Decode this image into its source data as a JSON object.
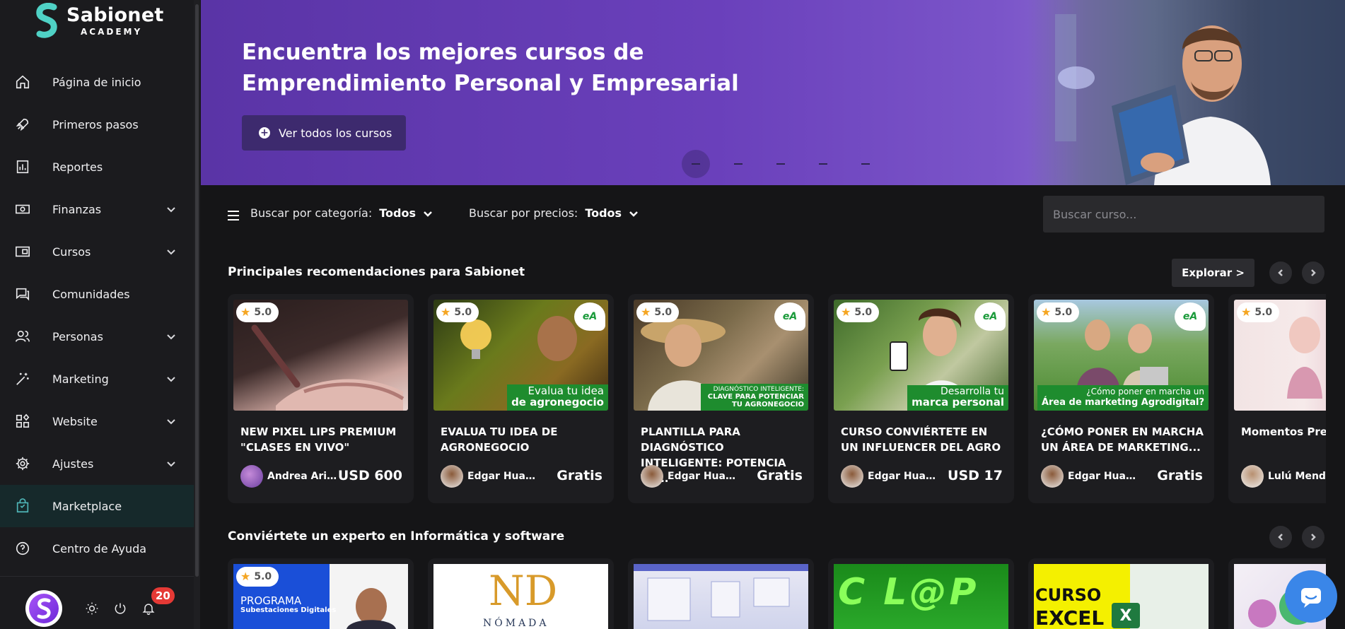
{
  "brand": {
    "name": "Sabionet",
    "sub": "ACADEMY"
  },
  "nav": [
    {
      "label": "Página de inicio",
      "icon": "home-icon",
      "chevron": false
    },
    {
      "label": "Primeros pasos",
      "icon": "rocket-icon",
      "chevron": false
    },
    {
      "label": "Reportes",
      "icon": "report-icon",
      "chevron": false
    },
    {
      "label": "Finanzas",
      "icon": "money-icon",
      "chevron": true
    },
    {
      "label": "Cursos",
      "icon": "course-icon",
      "chevron": true
    },
    {
      "label": "Comunidades",
      "icon": "chat-icon",
      "chevron": false
    },
    {
      "label": "Personas",
      "icon": "people-icon",
      "chevron": true
    },
    {
      "label": "Marketing",
      "icon": "magic-wand-icon",
      "chevron": true
    },
    {
      "label": "Website",
      "icon": "grid-icon",
      "chevron": true
    },
    {
      "label": "Ajustes",
      "icon": "gear-icon",
      "chevron": true
    },
    {
      "label": "Marketplace",
      "icon": "bag-icon",
      "chevron": false,
      "active": true
    },
    {
      "label": "Centro de Ayuda",
      "icon": "help-icon",
      "chevron": false
    }
  ],
  "footer": {
    "notifications": "20"
  },
  "banner": {
    "title": "Encuentra los mejores cursos de Emprendimiento Personal y Empresarial",
    "button": "Ver todos los cursos"
  },
  "filters": {
    "category_label": "Buscar por categoría:",
    "category_value": "Todos",
    "price_label": "Buscar por precios:",
    "price_value": "Todos",
    "search_placeholder": "Buscar curso..."
  },
  "section1": {
    "title": "Principales recomendaciones para Sabionet",
    "explore": "Explorar >"
  },
  "cards": [
    {
      "rating": "5.0",
      "title": "NEW PIXEL LIPS PREMIUM \"CLASES EN VIVO\"",
      "author": "Andrea Arias",
      "price": "USD 600"
    },
    {
      "rating": "5.0",
      "title": "EVALUA TU IDEA DE AGRONEGOCIO",
      "author": "Edgar Huam...",
      "price": "Gratis",
      "overlay1": "Evalua tu idea",
      "overlay2": "de agronegocio",
      "logo": "EDUCAGRO"
    },
    {
      "rating": "5.0",
      "title": "PLANTILLA PARA DIAGNÓSTICO INTELIGENTE: POTENCIA TU...",
      "author": "Edgar Huam...",
      "price": "Gratis",
      "overlay1": "DIAGNÓSTICO INTELIGENTE:",
      "overlay2": "CLAVE PARA POTENCIAR TU AGRONEGOCIO",
      "logo": "EDUCAGRO"
    },
    {
      "rating": "5.0",
      "title": "CURSO CONVIÉRTETE EN UN INFLUENCER DEL AGRO",
      "author": "Edgar Huam...",
      "price": "USD 17",
      "overlay1": "Desarrolla tu",
      "overlay2": "marca personal",
      "logo": "EDUCAGRO"
    },
    {
      "rating": "5.0",
      "title": "¿CÓMO PONER EN MARCHA UN ÁREA DE MARKETING...",
      "author": "Edgar Huam...",
      "price": "Gratis",
      "overlay1": "¿Cómo poner en marcha un",
      "overlay2": "Área de marketing Agrodigital?",
      "logo": "EDUCAGRO"
    },
    {
      "rating": "5.0",
      "title": "Momentos Preci",
      "author": "Lulú Mendoz",
      "price": ""
    }
  ],
  "section2": {
    "title": "Conviértete un experto en Informática y software"
  },
  "cards2": [
    {
      "rating": "5.0",
      "text1": "PROGRAMA",
      "text2": "Subestaciones Digitales"
    },
    {
      "text1": "ND",
      "text2": "NÓMADA"
    },
    {
      "text1": "",
      "text2": ""
    },
    {
      "text1": "C L@P",
      "text2": ""
    },
    {
      "text1": "CURSO",
      "text2": "EXCEL"
    },
    {
      "text1": "",
      "text2": ""
    }
  ],
  "colors": {
    "accent": "#6a40bb",
    "active_nav": "#4fb6b8",
    "badge": "#e53935"
  }
}
